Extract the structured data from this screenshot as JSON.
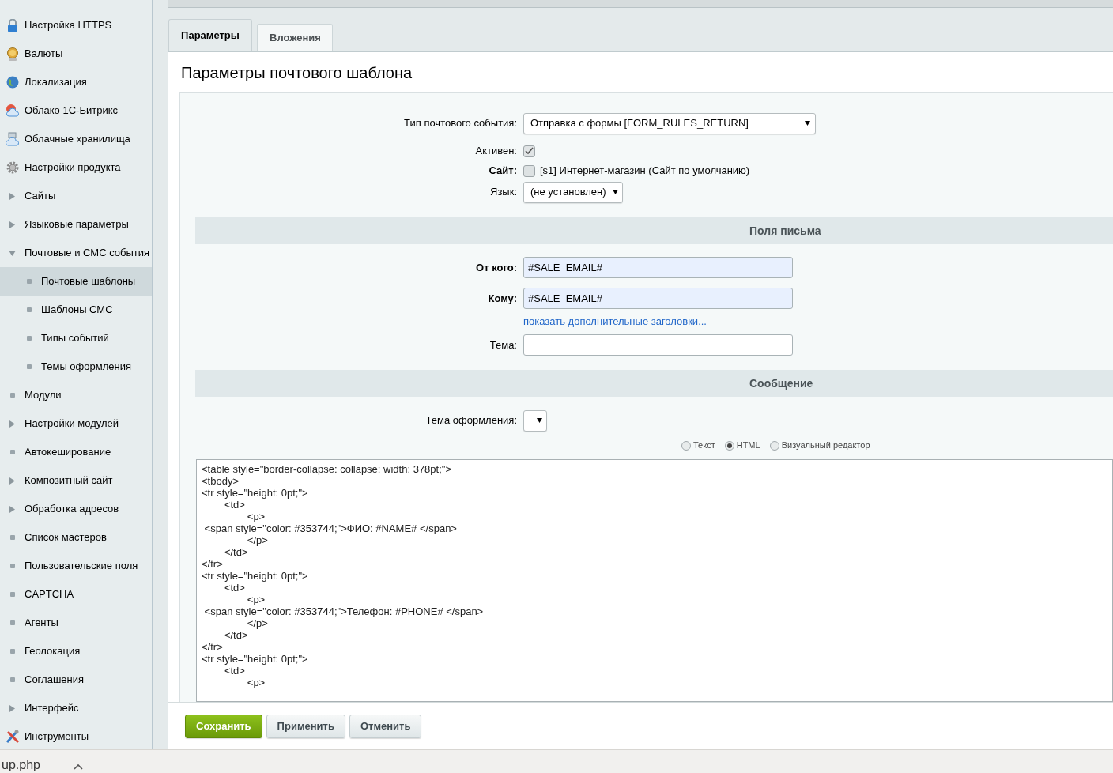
{
  "sidebar": {
    "items": [
      {
        "label": "Настройка HTTPS",
        "kind": "icon",
        "selected": false
      },
      {
        "label": "Валюты",
        "kind": "icon",
        "selected": false
      },
      {
        "label": "Локализация",
        "kind": "icon",
        "selected": false
      },
      {
        "label": "Облако 1С-Битрикс",
        "kind": "icon",
        "selected": false
      },
      {
        "label": "Облачные хранилища",
        "kind": "icon",
        "selected": false
      },
      {
        "label": "Настройки продукта",
        "kind": "icon",
        "selected": false
      },
      {
        "label": "Сайты",
        "kind": "branch",
        "expanded": false,
        "selected": false
      },
      {
        "label": "Языковые параметры",
        "kind": "branch",
        "expanded": false,
        "selected": false
      },
      {
        "label": "Почтовые и СМС события",
        "kind": "branch",
        "expanded": true,
        "selected": false,
        "children": [
          {
            "label": "Почтовые шаблоны",
            "kind": "leaf",
            "selected": true
          },
          {
            "label": "Шаблоны СМС",
            "kind": "leaf",
            "selected": false
          },
          {
            "label": "Типы событий",
            "kind": "leaf",
            "selected": false
          },
          {
            "label": "Темы оформления",
            "kind": "leaf",
            "selected": false
          }
        ]
      },
      {
        "label": "Модули",
        "kind": "leaf",
        "selected": false
      },
      {
        "label": "Настройки модулей",
        "kind": "branch",
        "expanded": false,
        "selected": false
      },
      {
        "label": "Автокеширование",
        "kind": "leaf",
        "selected": false
      },
      {
        "label": "Композитный сайт",
        "kind": "branch",
        "expanded": false,
        "selected": false
      },
      {
        "label": "Обработка адресов",
        "kind": "branch",
        "expanded": false,
        "selected": false
      },
      {
        "label": "Список мастеров",
        "kind": "leaf",
        "selected": false
      },
      {
        "label": "Пользовательские поля",
        "kind": "leaf",
        "selected": false
      },
      {
        "label": "CAPTCHA",
        "kind": "leaf",
        "selected": false
      },
      {
        "label": "Агенты",
        "kind": "leaf",
        "selected": false
      },
      {
        "label": "Геолокация",
        "kind": "leaf",
        "selected": false
      },
      {
        "label": "Соглашения",
        "kind": "leaf",
        "selected": false
      },
      {
        "label": "Интерфейс",
        "kind": "branch",
        "expanded": false,
        "selected": false
      },
      {
        "label": "Инструменты",
        "kind": "icon",
        "selected": false
      }
    ]
  },
  "tabs": [
    {
      "label": "Параметры",
      "selected": true
    },
    {
      "label": "Вложения",
      "selected": false
    }
  ],
  "title": "Параметры почтового шаблона",
  "form": {
    "event_type": {
      "label": "Тип почтового события:",
      "value": "Отправка с формы [FORM_RULES_RETURN]"
    },
    "active": {
      "label": "Активен:",
      "checked": true
    },
    "site": {
      "label": "Сайт:",
      "option": "[s1] Интернет-магазин (Сайт по умолчанию)",
      "checked": false
    },
    "language": {
      "label": "Язык:",
      "value": "(не установлен)"
    },
    "fields_header": "Поля письма",
    "from": {
      "label": "От кого:",
      "value": "#SALE_EMAIL#"
    },
    "to": {
      "label": "Кому:",
      "value": "#SALE_EMAIL#"
    },
    "more_headers_link": "показать дополнительные заголовки...",
    "subject": {
      "label": "Тема:"
    },
    "message_header": "Сообщение",
    "theme": {
      "label": "Тема оформления:"
    },
    "formats": [
      {
        "label": "Текст",
        "selected": false
      },
      {
        "label": "HTML",
        "selected": true
      },
      {
        "label": "Визуальный редактор",
        "selected": false
      }
    ],
    "body_lines": [
      "<table style=\"border-collapse: collapse; width: 378pt;\">",
      "<tbody>",
      "<tr style=\"height: 0pt;\">",
      "\t<td>",
      "\t\t<p>",
      " <span style=\"color: #353744;\">ФИО: #NAME# </span>",
      "\t\t</p>",
      "\t</td>",
      "</tr>",
      "<tr style=\"height: 0pt;\">",
      "\t<td>",
      "\t\t<p>",
      " <span style=\"color: #353744;\">Телефон: #PHONE# </span>",
      "\t\t</p>",
      "\t</td>",
      "</tr>",
      "<tr style=\"height: 0pt;\">",
      "\t<td>",
      "\t\t<p>"
    ]
  },
  "buttons": [
    {
      "label": "Сохранить",
      "kind": "primary"
    },
    {
      "label": "Применить",
      "kind": "normal"
    },
    {
      "label": "Отменить",
      "kind": "normal"
    }
  ],
  "download_bar": {
    "file": "up.php"
  }
}
